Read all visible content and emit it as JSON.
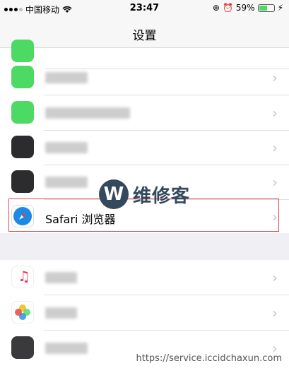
{
  "status_bar": {
    "carrier": "中国移动",
    "time": "23:47",
    "battery": "59%",
    "battery_fraction": 0.59
  },
  "nav": {
    "title": "设置"
  },
  "rows": [
    {
      "name": "row-blurred-1",
      "label": "",
      "icon_color": "#4cd964"
    },
    {
      "name": "row-blurred-2",
      "label": "",
      "icon_color": "#4cd964"
    },
    {
      "name": "row-blurred-3",
      "label": "",
      "icon_color": "#2c2c2e"
    },
    {
      "name": "row-blurred-4",
      "label": "",
      "icon_color": "#2c2c2e"
    },
    {
      "name": "row-safari",
      "label": "Safari 浏览器",
      "icon_color": "#1e88e5"
    }
  ],
  "rows2": [
    {
      "name": "row-music",
      "label": "",
      "icon_color": "#fa2d55"
    },
    {
      "name": "row-photos",
      "label": "",
      "icon_color": "#f0b500"
    },
    {
      "name": "row-camera",
      "label": "",
      "icon_color": "#3a3a3c"
    }
  ],
  "watermark": {
    "logo": "W",
    "text": "维修客"
  },
  "footer_url": "https://service.iccidchaxun.com",
  "colors": {
    "highlight": "#e0464e",
    "accent_green": "#4cd964"
  }
}
